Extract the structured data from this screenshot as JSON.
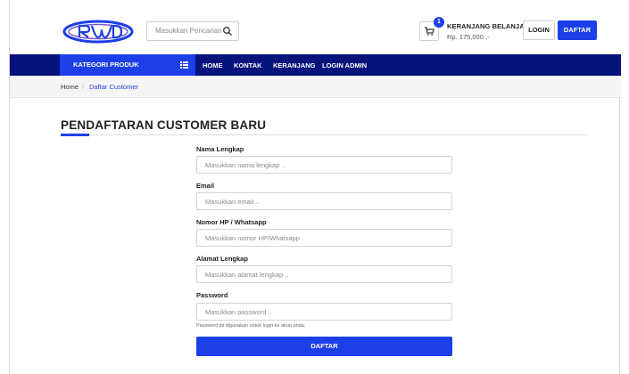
{
  "header": {
    "search_placeholder": "Masukkan Pencarian ..",
    "cart_count": "1",
    "cart_title": "KERANJANG BELANJA :",
    "cart_total": "Rp. 175,000 ,-",
    "login_label": "LOGIN",
    "register_label": "DAFTAR"
  },
  "nav": {
    "category_label": "KATEGORI PRODUK",
    "items": [
      "HOME",
      "KONTAK",
      "KERANJANG",
      "LOGIN ADMIN"
    ]
  },
  "breadcrumb": {
    "home": "Home",
    "separator": "/",
    "current": "Daftar Customer"
  },
  "form": {
    "title": "PENDAFTARAN CUSTOMER BARU",
    "fields": [
      {
        "label": "Nama Lengkap",
        "placeholder": "Masukkan nama lengkap .."
      },
      {
        "label": "Email",
        "placeholder": "Masukkan email .."
      },
      {
        "label": "Nomor HP / Whatsapp",
        "placeholder": "Masukkan nomor HP/Whatsapp .."
      },
      {
        "label": "Alamat Lengkap",
        "placeholder": "Masukkan alamat lengkap .."
      },
      {
        "label": "Password",
        "placeholder": "Masukkan password .."
      }
    ],
    "password_hint": "Password ini digunakan untuk login ke akun anda.",
    "submit_label": "DAFTAR"
  },
  "colors": {
    "accent": "#1d3fe8",
    "nav_bg": "#06137d"
  },
  "icons": {
    "search": "search-icon",
    "cart": "cart-icon",
    "menu": "list-icon",
    "logo": "logo-icon"
  }
}
